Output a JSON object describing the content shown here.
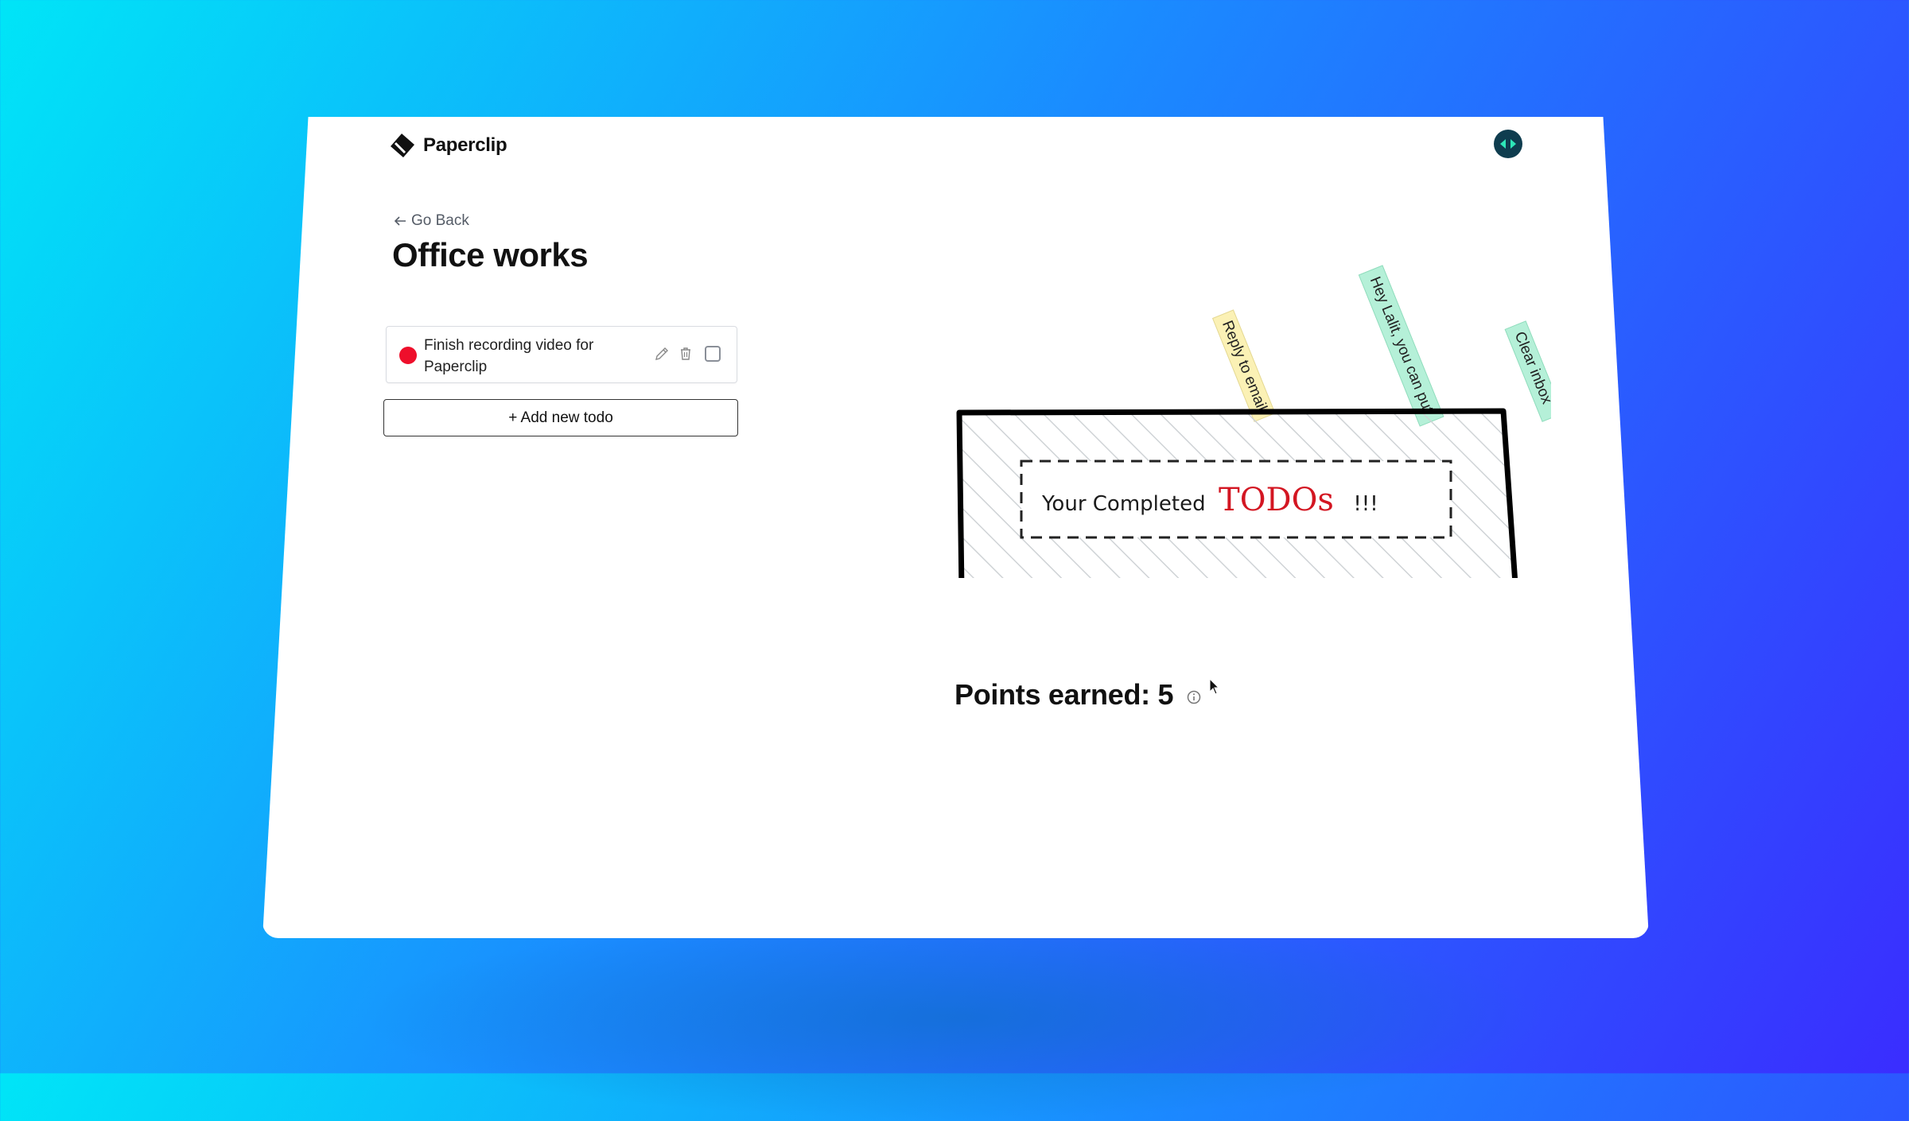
{
  "app": {
    "name": "Paperclip"
  },
  "nav": {
    "back_label": "Go Back"
  },
  "page": {
    "title": "Office works"
  },
  "todos": [
    {
      "text": "Finish recording video for Paperclip",
      "color": "#ee0f2b"
    }
  ],
  "add_todo_label": "+ Add new todo",
  "completed_box": {
    "label_prefix": "Your Completed",
    "label_highlight": "TODOs",
    "label_suffix": "!!!"
  },
  "completed_notes": [
    {
      "text": "Reply to email",
      "color": "#fbf1b5"
    },
    {
      "text": "Hey Lalit, you can put",
      "color": "#b5f0d8"
    },
    {
      "text": "Clear inbox",
      "color": "#b5f0d8"
    }
  ],
  "points": {
    "text": "Points earned: 5"
  },
  "colors": {
    "accent_red": "#ee0f2b",
    "avatar_bg": "#0f3d4f",
    "avatar_glyph": "#2ee6b8"
  },
  "icons": [
    "paperclip-logo-icon",
    "back-arrow-icon",
    "pencil-icon",
    "trash-icon",
    "info-icon",
    "avatar-icon"
  ]
}
